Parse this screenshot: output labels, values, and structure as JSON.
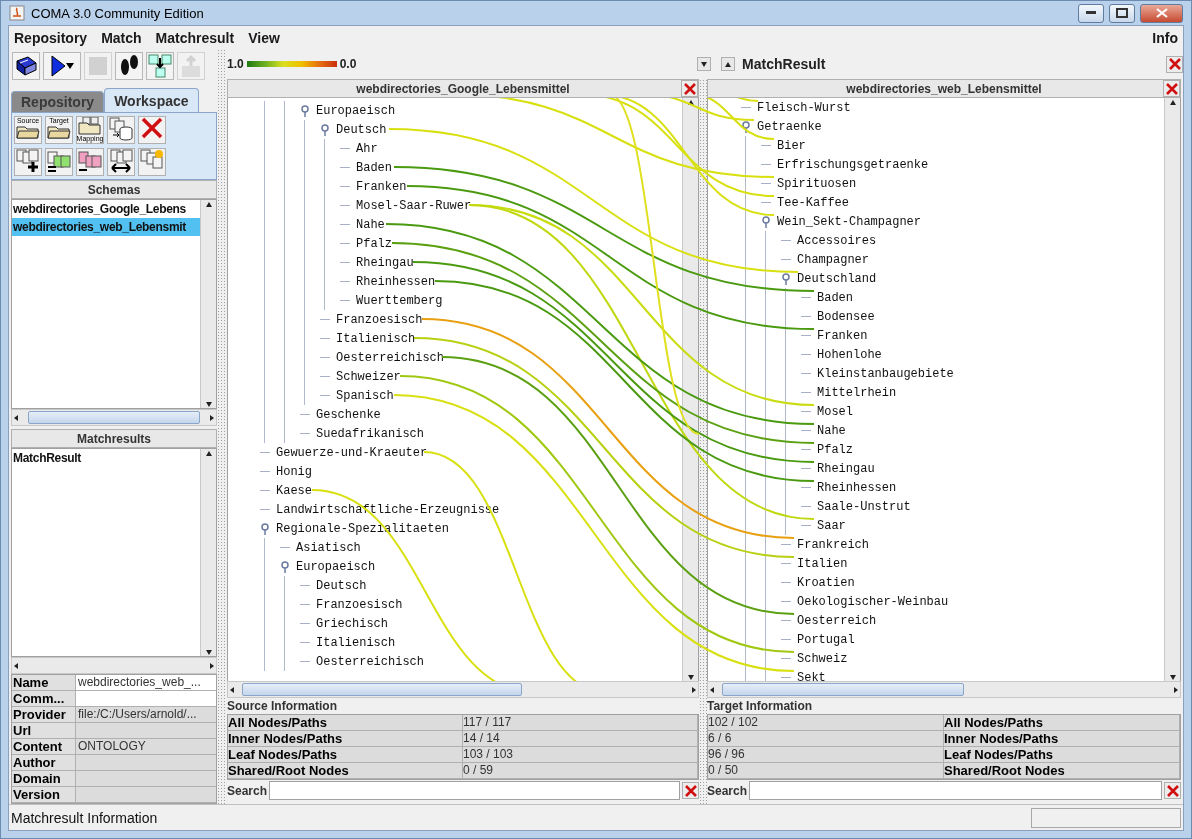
{
  "window": {
    "title": "COMA 3.0 Community Edition"
  },
  "menu": [
    {
      "label": "Repository"
    },
    {
      "label": "Match"
    },
    {
      "label": "Matchresult"
    },
    {
      "label": "View"
    }
  ],
  "menu_right": "Info",
  "toolbar": [
    {
      "kind": "database",
      "disabled": false
    },
    {
      "kind": "run",
      "disabled": false
    },
    {
      "kind": "stop",
      "disabled": true
    },
    {
      "kind": "steps",
      "disabled": false
    },
    {
      "kind": "import",
      "disabled": false
    },
    {
      "kind": "export",
      "disabled": true
    }
  ],
  "tabs": [
    {
      "label": "Repository",
      "selected": false
    },
    {
      "label": "Workspace",
      "selected": true
    }
  ],
  "workspace_tools": [
    {
      "kind": "folder",
      "caption": "Source"
    },
    {
      "kind": "folder",
      "caption": "Target"
    },
    {
      "kind": "mapping",
      "caption": "Mapping"
    },
    {
      "kind": "store"
    },
    {
      "kind": "delete"
    },
    {
      "kind": "add"
    },
    {
      "kind": "equal"
    },
    {
      "kind": "minus"
    },
    {
      "kind": "swap"
    },
    {
      "kind": "new"
    }
  ],
  "schemas": {
    "title": "Schemas",
    "items": [
      {
        "label": "webdirectories_Google_Lebens",
        "selected": false
      },
      {
        "label": "webdirectories_web_Lebensmit",
        "selected": true
      }
    ]
  },
  "matchresults": {
    "title": "Matchresults",
    "items": [
      {
        "label": "MatchResult",
        "selected": false
      }
    ]
  },
  "properties": [
    {
      "name": "Name",
      "value": "webdirectories_web_...",
      "editable": true
    },
    {
      "name": "Comm...",
      "editable": true
    },
    {
      "name": "Provider",
      "value": "file:/C:/Users/arnold/...",
      "editable": false
    },
    {
      "name": "Url",
      "editable": false
    },
    {
      "name": "Content",
      "value": "ONTOLOGY",
      "editable": false
    },
    {
      "name": "Author",
      "editable": false
    },
    {
      "name": "Domain",
      "editable": false
    },
    {
      "name": "Version",
      "editable": false
    }
  ],
  "legend": {
    "high": "1.0",
    "low": "0.0"
  },
  "match_title": "MatchResult",
  "source": {
    "title": "webdirectories_Google_Lebensmittel",
    "info_title": "Source Information",
    "search_label": "Search",
    "tree": [
      {
        "children": [
          {
            "children": [
              {
                "label": "Europaeisch",
                "children": [
                  {
                    "label": "Deutsch",
                    "children": [
                      {
                        "label": "Ahr"
                      },
                      {
                        "label": "Baden"
                      },
                      {
                        "label": "Franken"
                      },
                      {
                        "label": "Mosel-Saar-Ruwer"
                      },
                      {
                        "label": "Nahe"
                      },
                      {
                        "label": "Pfalz"
                      },
                      {
                        "label": "Rheingau"
                      },
                      {
                        "label": "Rheinhessen"
                      },
                      {
                        "label": "Wuerttemberg"
                      }
                    ]
                  },
                  {
                    "label": "Franzoesisch"
                  },
                  {
                    "label": "Italienisch"
                  },
                  {
                    "label": "Oesterreichisch"
                  },
                  {
                    "label": "Schweizer"
                  },
                  {
                    "label": "Spanisch"
                  }
                ]
              },
              {
                "label": "Geschenke"
              },
              {
                "label": "Suedafrikanisch"
              }
            ]
          }
        ]
      },
      {
        "label": "Gewuerze-und-Kraeuter"
      },
      {
        "label": "Honig"
      },
      {
        "label": "Kaese"
      },
      {
        "label": "Landwirtschaftliche-Erzeugnisse"
      },
      {
        "label": "Regionale-Spezialitaeten",
        "children": [
          {
            "label": "Asiatisch"
          },
          {
            "label": "Europaeisch",
            "children": [
              {
                "label": "Deutsch"
              },
              {
                "label": "Franzoesisch"
              },
              {
                "label": "Griechisch"
              },
              {
                "label": "Italienisch"
              },
              {
                "label": "Oesterreichisch"
              }
            ]
          }
        ]
      }
    ],
    "info": [
      {
        "label": "All Nodes/Paths",
        "value": "117 / 117"
      },
      {
        "label": "Inner Nodes/Paths",
        "value": "14 / 14"
      },
      {
        "label": "Leaf Nodes/Paths",
        "value": "103 / 103"
      },
      {
        "label": "Shared/Root Nodes",
        "value": "0 / 59"
      }
    ]
  },
  "target": {
    "title": "webdirectories_web_Lebensmittel",
    "info_title": "Target Information",
    "search_label": "Search",
    "tree": [
      {
        "label": "Fleisch-Wurst"
      },
      {
        "label": "Getraenke",
        "children": [
          {
            "label": "Bier"
          },
          {
            "label": "Erfrischungsgetraenke"
          },
          {
            "label": "Spirituosen"
          },
          {
            "label": "Tee-Kaffee"
          },
          {
            "label": "Wein_Sekt-Champagner",
            "children": [
              {
                "label": "Accessoires"
              },
              {
                "label": "Champagner"
              },
              {
                "label": "Deutschland",
                "children": [
                  {
                    "label": "Baden"
                  },
                  {
                    "label": "Bodensee"
                  },
                  {
                    "label": "Franken"
                  },
                  {
                    "label": "Hohenlohe"
                  },
                  {
                    "label": "Kleinstanbaugebiete"
                  },
                  {
                    "label": "Mittelrhein"
                  },
                  {
                    "label": "Mosel"
                  },
                  {
                    "label": "Nahe"
                  },
                  {
                    "label": "Pfalz"
                  },
                  {
                    "label": "Rheingau"
                  },
                  {
                    "label": "Rheinhessen"
                  },
                  {
                    "label": "Saale-Unstrut"
                  },
                  {
                    "label": "Saar"
                  }
                ]
              },
              {
                "label": "Frankreich"
              },
              {
                "label": "Italien"
              },
              {
                "label": "Kroatien"
              },
              {
                "label": "Oekologischer-Weinbau"
              },
              {
                "label": "Oesterreich"
              },
              {
                "label": "Portugal"
              },
              {
                "label": "Schweiz"
              },
              {
                "label": "Sekt"
              }
            ]
          }
        ]
      }
    ],
    "info": [
      {
        "label": "All Nodes/Paths",
        "value": "102 / 102"
      },
      {
        "label": "Inner Nodes/Paths",
        "value": "6 / 6"
      },
      {
        "label": "Leaf Nodes/Paths",
        "value": "96 / 96"
      },
      {
        "label": "Shared/Root Nodes",
        "value": "0 / 50"
      }
    ]
  },
  "status": "Matchresult Information"
}
